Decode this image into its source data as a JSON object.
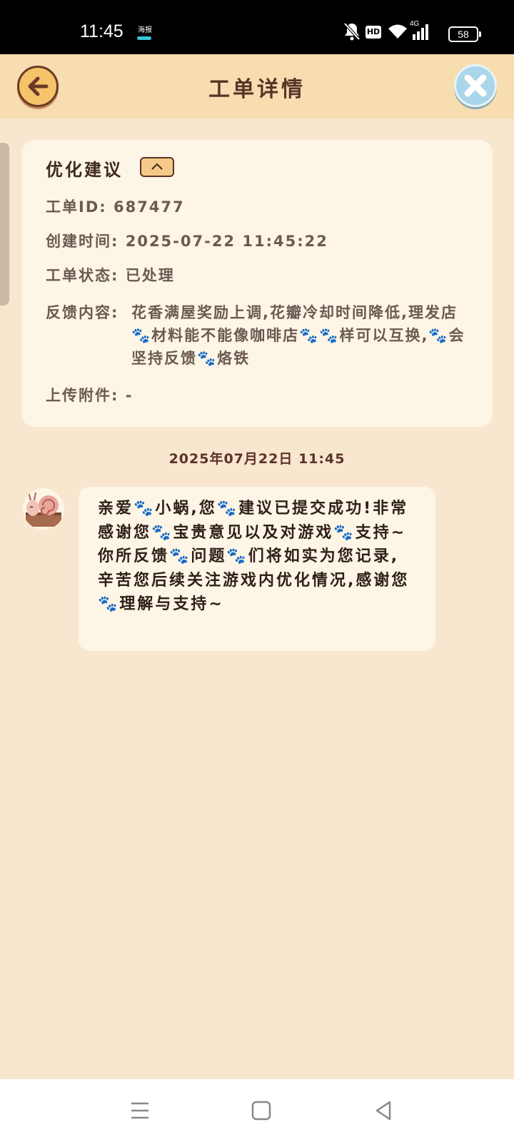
{
  "status_bar": {
    "time": "11:45",
    "small_icon_text": "海报",
    "network": "4G",
    "battery": "58"
  },
  "header": {
    "title": "工单详情",
    "back_icon": "back-arrow-icon",
    "close_icon": "close-icon"
  },
  "ticket": {
    "type": "优化建议",
    "id_label": "工单ID:",
    "id_value": "687477",
    "created_label": "创建时间:",
    "created_value": "2025-07-22 11:45:22",
    "status_label": "工单状态:",
    "status_value": "已处理",
    "feedback_label": "反馈内容:",
    "feedback_value": "花香满屋奖励上调,花瓣冷却时间降低,理发店🐾材料能不能像咖啡店🐾🐾样可以互换,🐾会坚持反馈🐾烙铁",
    "attachment_label": "上传附件:",
    "attachment_value": "-"
  },
  "chat": {
    "timestamp": "2025年07月22日 11:45",
    "message": "亲爱🐾小蜗,您🐾建议已提交成功!非常感谢您🐾宝贵意见以及对游戏🐾支持~你所反馈🐾问题🐾们将如实为您记录,辛苦您后续关注游戏内优化情况,感谢您🐾理解与支持~"
  },
  "colors": {
    "background": "#f9e6cf",
    "header": "#f7ddb0",
    "card": "#fdf5e6",
    "title_text": "#5a3326"
  }
}
